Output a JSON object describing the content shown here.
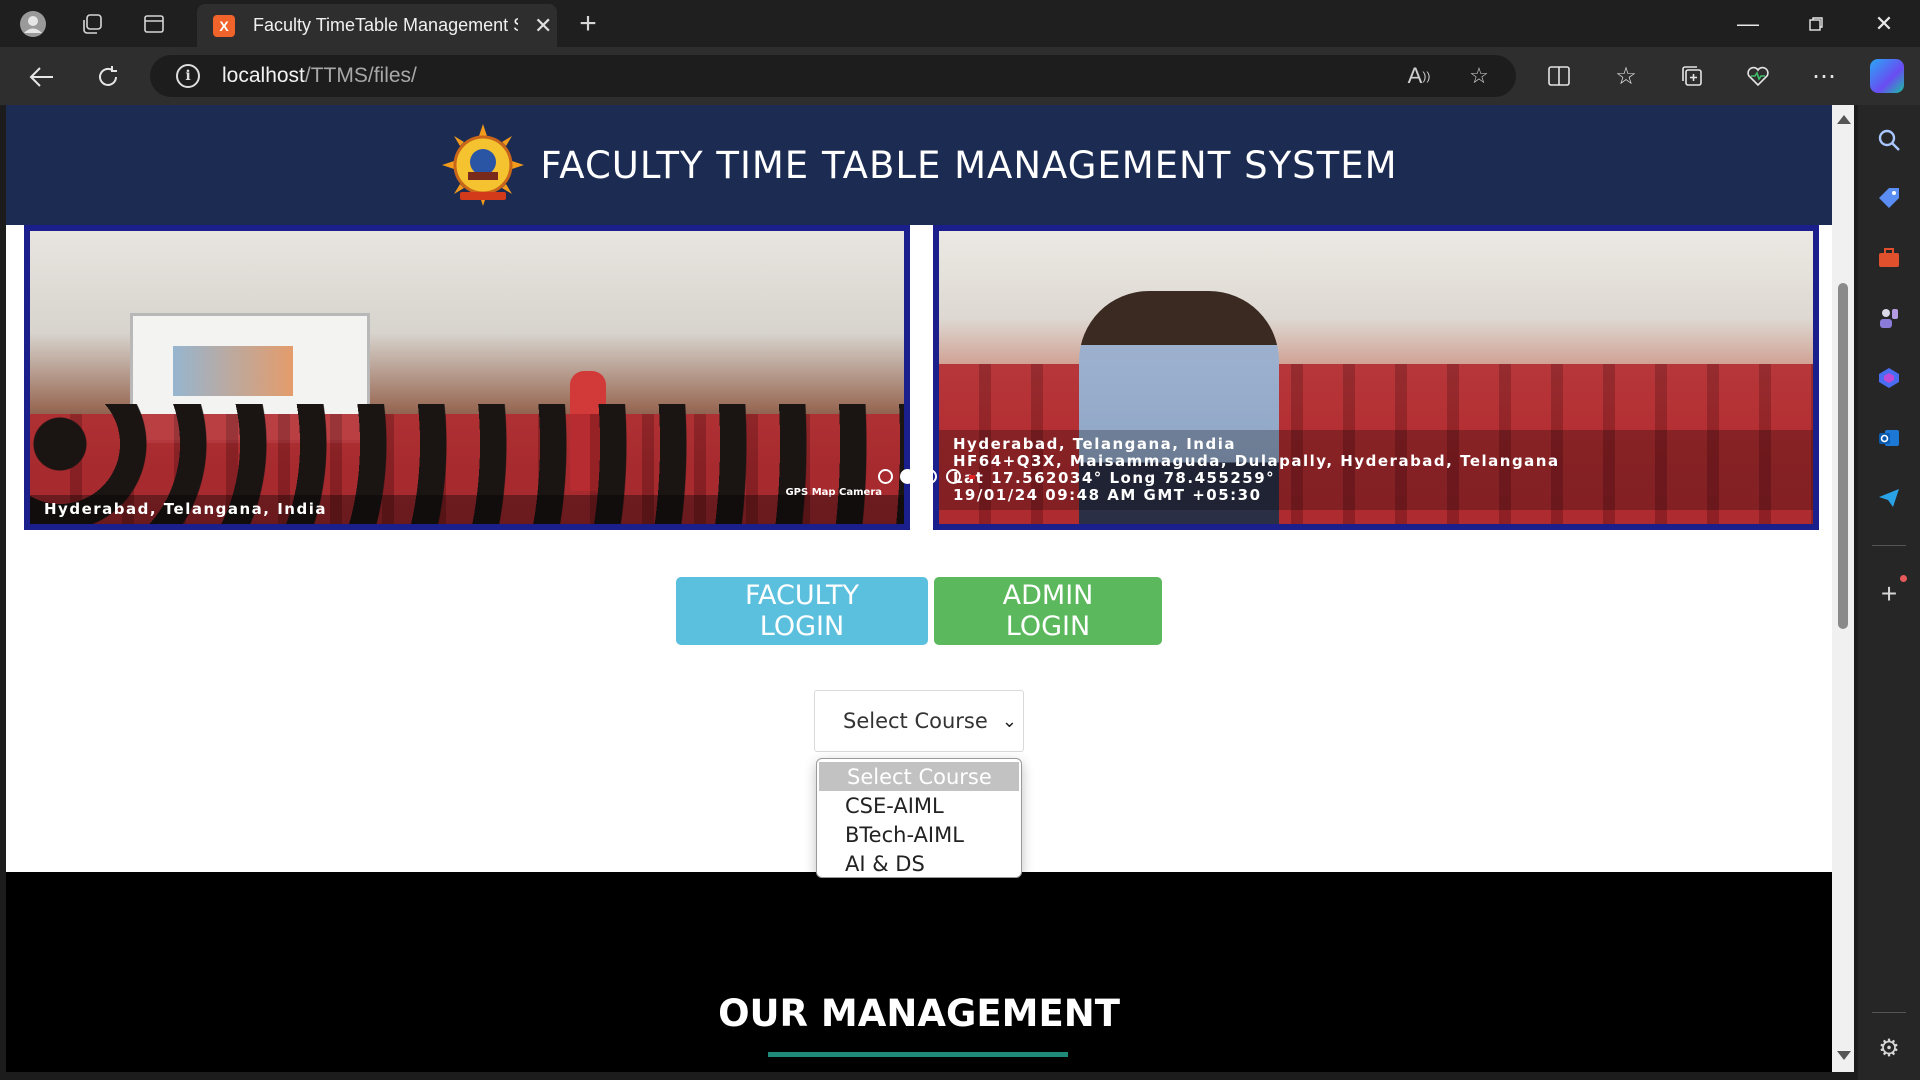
{
  "browser": {
    "tab_title": "Faculty TimeTable Management S",
    "tab_favicon_letter": "X",
    "url_host": "localhost",
    "url_path": "/TTMS/files/"
  },
  "header": {
    "title": "FACULTY TIME TABLE MANAGEMENT SYSTEM"
  },
  "carousel": {
    "slides": [
      {
        "geotag_lines": [
          "Hyderabad, Telangana, India"
        ],
        "badge": "GPS Map Camera"
      },
      {
        "geotag_lines": [
          "Hyderabad, Telangana, India",
          "HF64+Q3X, Maisammaguda, Dulapally, Hyderabad, Telangana",
          "Lat 17.562034° Long 78.455259°",
          "19/01/24 09:48 AM GMT +05:30"
        ]
      }
    ],
    "active_index": 1
  },
  "buttons": {
    "faculty_login": "FACULTY LOGIN",
    "admin_login": "ADMIN LOGIN"
  },
  "course_select": {
    "selected": "Select Course",
    "options": [
      "Select Course",
      "CSE-AIML",
      "BTech-AIML",
      "AI & DS"
    ]
  },
  "management": {
    "title": "OUR MANAGEMENT"
  },
  "colors": {
    "header_bg": "#1c2b52",
    "faculty_btn": "#5bc0de",
    "admin_btn": "#5cb85c",
    "underline": "#1f8a7a"
  }
}
